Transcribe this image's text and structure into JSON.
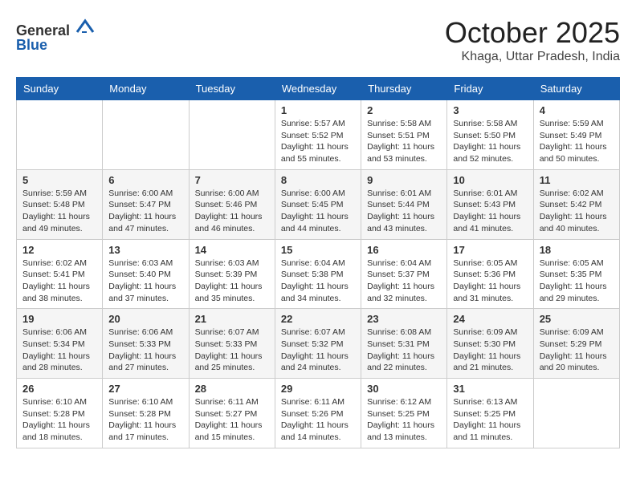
{
  "header": {
    "logo_line1": "General",
    "logo_line2": "Blue",
    "month": "October 2025",
    "location": "Khaga, Uttar Pradesh, India"
  },
  "days_of_week": [
    "Sunday",
    "Monday",
    "Tuesday",
    "Wednesday",
    "Thursday",
    "Friday",
    "Saturday"
  ],
  "weeks": [
    [
      {
        "day": "",
        "content": ""
      },
      {
        "day": "",
        "content": ""
      },
      {
        "day": "",
        "content": ""
      },
      {
        "day": "1",
        "content": "Sunrise: 5:57 AM\nSunset: 5:52 PM\nDaylight: 11 hours\nand 55 minutes."
      },
      {
        "day": "2",
        "content": "Sunrise: 5:58 AM\nSunset: 5:51 PM\nDaylight: 11 hours\nand 53 minutes."
      },
      {
        "day": "3",
        "content": "Sunrise: 5:58 AM\nSunset: 5:50 PM\nDaylight: 11 hours\nand 52 minutes."
      },
      {
        "day": "4",
        "content": "Sunrise: 5:59 AM\nSunset: 5:49 PM\nDaylight: 11 hours\nand 50 minutes."
      }
    ],
    [
      {
        "day": "5",
        "content": "Sunrise: 5:59 AM\nSunset: 5:48 PM\nDaylight: 11 hours\nand 49 minutes."
      },
      {
        "day": "6",
        "content": "Sunrise: 6:00 AM\nSunset: 5:47 PM\nDaylight: 11 hours\nand 47 minutes."
      },
      {
        "day": "7",
        "content": "Sunrise: 6:00 AM\nSunset: 5:46 PM\nDaylight: 11 hours\nand 46 minutes."
      },
      {
        "day": "8",
        "content": "Sunrise: 6:00 AM\nSunset: 5:45 PM\nDaylight: 11 hours\nand 44 minutes."
      },
      {
        "day": "9",
        "content": "Sunrise: 6:01 AM\nSunset: 5:44 PM\nDaylight: 11 hours\nand 43 minutes."
      },
      {
        "day": "10",
        "content": "Sunrise: 6:01 AM\nSunset: 5:43 PM\nDaylight: 11 hours\nand 41 minutes."
      },
      {
        "day": "11",
        "content": "Sunrise: 6:02 AM\nSunset: 5:42 PM\nDaylight: 11 hours\nand 40 minutes."
      }
    ],
    [
      {
        "day": "12",
        "content": "Sunrise: 6:02 AM\nSunset: 5:41 PM\nDaylight: 11 hours\nand 38 minutes."
      },
      {
        "day": "13",
        "content": "Sunrise: 6:03 AM\nSunset: 5:40 PM\nDaylight: 11 hours\nand 37 minutes."
      },
      {
        "day": "14",
        "content": "Sunrise: 6:03 AM\nSunset: 5:39 PM\nDaylight: 11 hours\nand 35 minutes."
      },
      {
        "day": "15",
        "content": "Sunrise: 6:04 AM\nSunset: 5:38 PM\nDaylight: 11 hours\nand 34 minutes."
      },
      {
        "day": "16",
        "content": "Sunrise: 6:04 AM\nSunset: 5:37 PM\nDaylight: 11 hours\nand 32 minutes."
      },
      {
        "day": "17",
        "content": "Sunrise: 6:05 AM\nSunset: 5:36 PM\nDaylight: 11 hours\nand 31 minutes."
      },
      {
        "day": "18",
        "content": "Sunrise: 6:05 AM\nSunset: 5:35 PM\nDaylight: 11 hours\nand 29 minutes."
      }
    ],
    [
      {
        "day": "19",
        "content": "Sunrise: 6:06 AM\nSunset: 5:34 PM\nDaylight: 11 hours\nand 28 minutes."
      },
      {
        "day": "20",
        "content": "Sunrise: 6:06 AM\nSunset: 5:33 PM\nDaylight: 11 hours\nand 27 minutes."
      },
      {
        "day": "21",
        "content": "Sunrise: 6:07 AM\nSunset: 5:33 PM\nDaylight: 11 hours\nand 25 minutes."
      },
      {
        "day": "22",
        "content": "Sunrise: 6:07 AM\nSunset: 5:32 PM\nDaylight: 11 hours\nand 24 minutes."
      },
      {
        "day": "23",
        "content": "Sunrise: 6:08 AM\nSunset: 5:31 PM\nDaylight: 11 hours\nand 22 minutes."
      },
      {
        "day": "24",
        "content": "Sunrise: 6:09 AM\nSunset: 5:30 PM\nDaylight: 11 hours\nand 21 minutes."
      },
      {
        "day": "25",
        "content": "Sunrise: 6:09 AM\nSunset: 5:29 PM\nDaylight: 11 hours\nand 20 minutes."
      }
    ],
    [
      {
        "day": "26",
        "content": "Sunrise: 6:10 AM\nSunset: 5:28 PM\nDaylight: 11 hours\nand 18 minutes."
      },
      {
        "day": "27",
        "content": "Sunrise: 6:10 AM\nSunset: 5:28 PM\nDaylight: 11 hours\nand 17 minutes."
      },
      {
        "day": "28",
        "content": "Sunrise: 6:11 AM\nSunset: 5:27 PM\nDaylight: 11 hours\nand 15 minutes."
      },
      {
        "day": "29",
        "content": "Sunrise: 6:11 AM\nSunset: 5:26 PM\nDaylight: 11 hours\nand 14 minutes."
      },
      {
        "day": "30",
        "content": "Sunrise: 6:12 AM\nSunset: 5:25 PM\nDaylight: 11 hours\nand 13 minutes."
      },
      {
        "day": "31",
        "content": "Sunrise: 6:13 AM\nSunset: 5:25 PM\nDaylight: 11 hours\nand 11 minutes."
      },
      {
        "day": "",
        "content": ""
      }
    ]
  ]
}
